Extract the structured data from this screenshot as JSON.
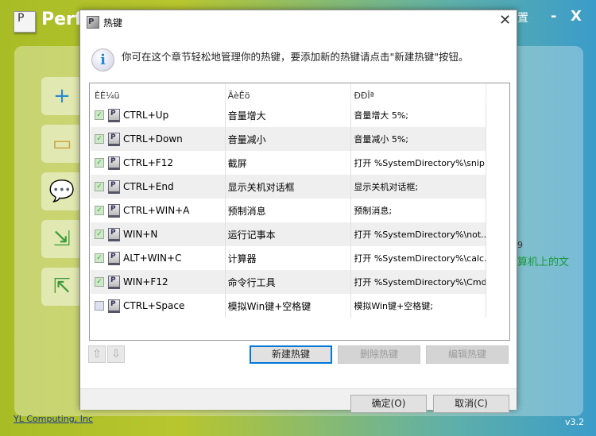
{
  "app": {
    "title": "Perf",
    "logo_letter": "P",
    "partial_title_right": "置",
    "minimize": "-",
    "close": "X",
    "partial_number": "9",
    "partial_text": "算机上的文",
    "company_link": "YL Computing, Inc",
    "version": "v3.2"
  },
  "dialog": {
    "title": "热键",
    "icon_letter": "P",
    "info": "你可在这个章节轻松地管理你的热键，要添加新的热键请点击\"新建热键\"按钮。",
    "columns": [
      "ÈÈ¼ü",
      "ÃèÊö",
      "ÐÐÎª"
    ],
    "rows": [
      {
        "enabled": true,
        "key": "CTRL+Up",
        "name": "音量增大",
        "action": "音量增大 5%;"
      },
      {
        "enabled": true,
        "key": "CTRL+Down",
        "name": "音量减小",
        "action": "音量减小 5%;"
      },
      {
        "enabled": true,
        "key": "CTRL+F12",
        "name": "截屏",
        "action": "打开 %SystemDirectory%\\snip..."
      },
      {
        "enabled": true,
        "key": "CTRL+End",
        "name": "显示关机对话框",
        "action": "显示关机对话框;"
      },
      {
        "enabled": true,
        "key": "CTRL+WIN+A",
        "name": "预制消息",
        "action": "预制消息;"
      },
      {
        "enabled": true,
        "key": "WIN+N",
        "name": "运行记事本",
        "action": "打开 %SystemDirectory%\\not..."
      },
      {
        "enabled": true,
        "key": "ALT+WIN+C",
        "name": "计算器",
        "action": "打开 %SystemDirectory%\\calc...."
      },
      {
        "enabled": true,
        "key": "WIN+F12",
        "name": "命令行工具",
        "action": "打开 %SystemDirectory%\\Cmd..."
      },
      {
        "enabled": false,
        "key": "CTRL+Space",
        "name": "模拟Win键+空格键",
        "action": "模拟Win键+空格键;"
      }
    ],
    "buttons": {
      "move_up": "⇧",
      "move_down": "⇩",
      "new": "新建热键",
      "delete": "删除热键",
      "edit": "编辑热键",
      "ok": "确定(O)",
      "cancel": "取消(C)"
    }
  }
}
